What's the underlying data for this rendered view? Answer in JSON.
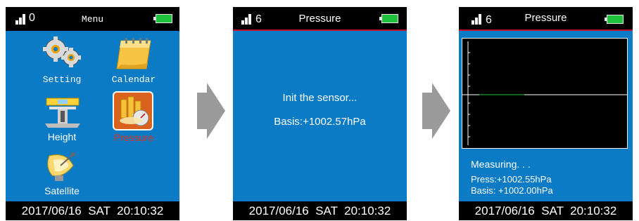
{
  "screens": {
    "menu": {
      "signal_value": "0",
      "title": "Menu",
      "items": [
        {
          "label": "Setting"
        },
        {
          "label": "Calendar"
        },
        {
          "label": "Height"
        },
        {
          "label": "Pressure"
        },
        {
          "label": "Satellite"
        }
      ],
      "selected_item": "Pressure",
      "status_bar": "2017/06/16  SAT  20:10:32"
    },
    "init": {
      "signal_value": "6",
      "title": "Pressure",
      "line1": "Init the sensor...",
      "line2": "Basis:+1002.57hPa",
      "status_bar": "2017/06/16  SAT  20:10:32"
    },
    "measuring": {
      "signal_value": "6",
      "title": "Pressure",
      "status": "Measuring. . .",
      "press": "Press:+1002.55hPa",
      "basis": "Basis: +1002.00hPa",
      "status_bar": "2017/06/16  SAT  20:10:32"
    }
  },
  "colors": {
    "screen_bg": "#0a7bc4",
    "bar_bg": "#000000",
    "battery": "#1ec33b",
    "accent_red": "#c8102e",
    "selected_label": "#e03020",
    "arrow": "#9a9a9a"
  },
  "icons": {
    "signal": "signal-bars-icon",
    "battery": "battery-icon",
    "setting": "gears-icon",
    "calendar": "calendar-icon",
    "height": "level-icon",
    "pressure": "gauge-icon",
    "satellite": "satellite-dish-icon",
    "flow": "arrow-right-icon"
  }
}
